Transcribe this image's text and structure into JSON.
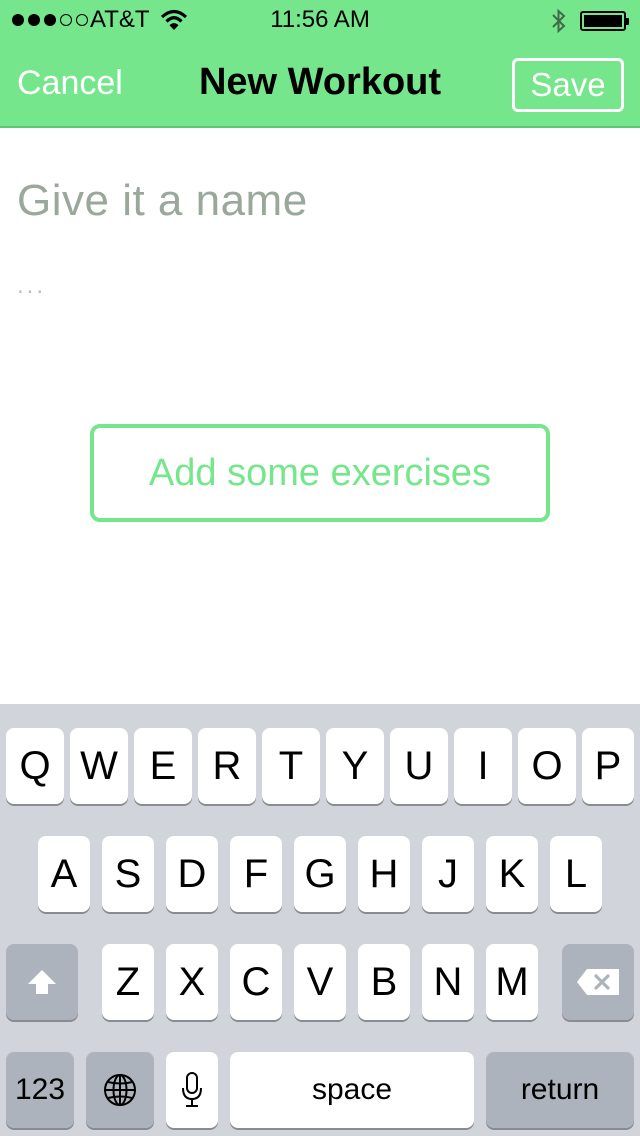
{
  "status_bar": {
    "carrier": "AT&T",
    "time": "11:56 AM",
    "signal_bars_filled": 3,
    "signal_bars_total": 5,
    "battery_level": 1.0
  },
  "nav": {
    "cancel_label": "Cancel",
    "title": "New Workout",
    "save_label": "Save"
  },
  "form": {
    "name_placeholder": "Give it a name",
    "description_placeholder": "...",
    "add_exercises_label": "Add some exercises"
  },
  "keyboard": {
    "row1": [
      "Q",
      "W",
      "E",
      "R",
      "T",
      "Y",
      "U",
      "I",
      "O",
      "P"
    ],
    "row2": [
      "A",
      "S",
      "D",
      "F",
      "G",
      "H",
      "J",
      "K",
      "L"
    ],
    "row3": [
      "Z",
      "X",
      "C",
      "V",
      "B",
      "N",
      "M"
    ],
    "numbers_label": "123",
    "space_label": "space",
    "return_label": "return"
  },
  "colors": {
    "accent_green": "#76e68c",
    "keyboard_bg": "#d1d5db"
  }
}
